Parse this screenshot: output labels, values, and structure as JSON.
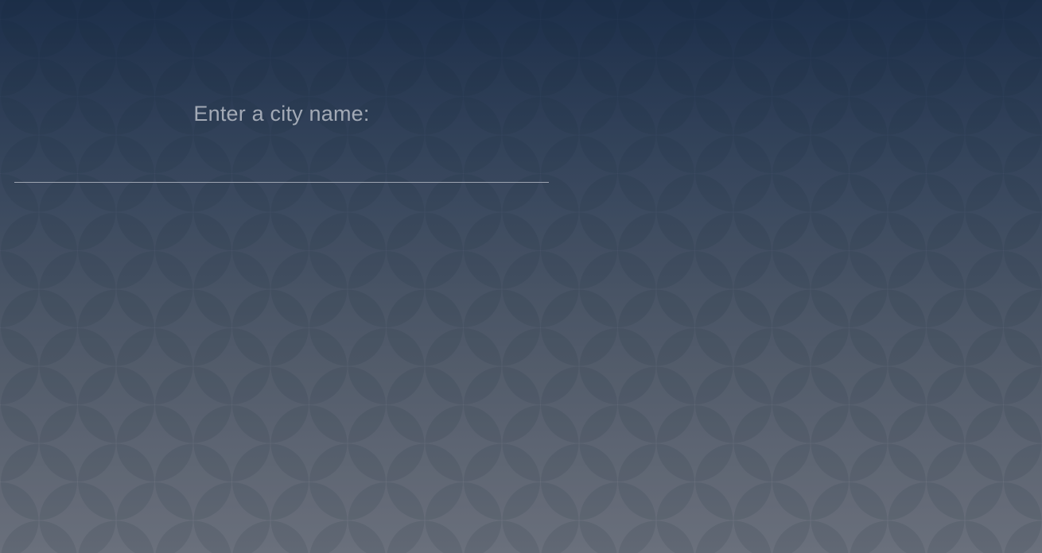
{
  "search": {
    "label": "Enter a city name:",
    "value": "",
    "placeholder": ""
  },
  "background": {
    "pattern": "overlapping-scallop-circles",
    "gradient_top_color": "#1f314d",
    "gradient_bottom_color": "#757984"
  }
}
